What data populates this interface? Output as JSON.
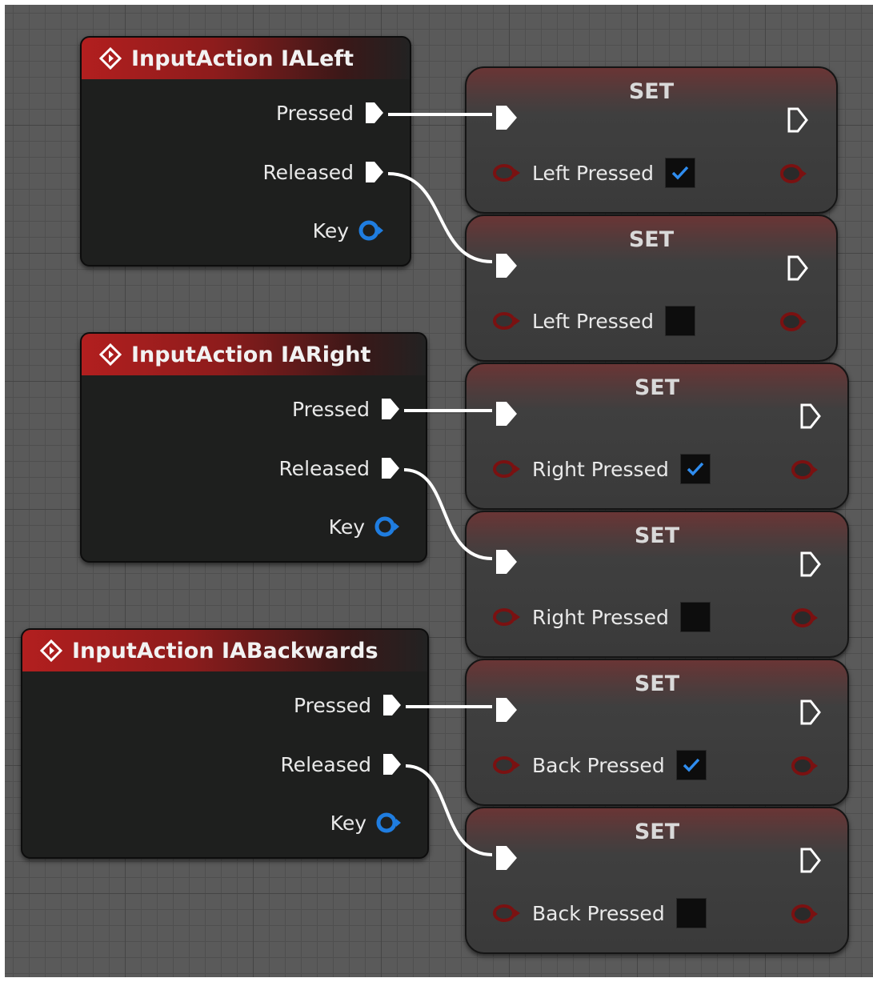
{
  "input_actions": [
    {
      "title": "InputAction IALeft",
      "pressed_label": "Pressed",
      "released_label": "Released",
      "key_label": "Key"
    },
    {
      "title": "InputAction IARight",
      "pressed_label": "Pressed",
      "released_label": "Released",
      "key_label": "Key"
    },
    {
      "title": "InputAction IABackwards",
      "pressed_label": "Pressed",
      "released_label": "Released",
      "key_label": "Key"
    }
  ],
  "set_nodes": [
    {
      "title": "SET",
      "variable": "Left Pressed",
      "checked": true
    },
    {
      "title": "SET",
      "variable": "Left Pressed",
      "checked": false
    },
    {
      "title": "SET",
      "variable": "Right Pressed",
      "checked": true
    },
    {
      "title": "SET",
      "variable": "Right Pressed",
      "checked": false
    },
    {
      "title": "SET",
      "variable": "Back Pressed",
      "checked": true
    },
    {
      "title": "SET",
      "variable": "Back Pressed",
      "checked": false
    }
  ],
  "colors": {
    "header_red": "#b21f1f",
    "key_pin_blue": "#1f7de0",
    "bool_pin_red": "#7a1111",
    "check_blue": "#2f8df0"
  },
  "icons": [
    "input-action-icon",
    "exec-pin-icon",
    "key-pin-icon",
    "bool-pin-icon",
    "checkmark-icon"
  ]
}
